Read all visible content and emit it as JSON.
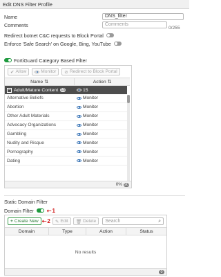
{
  "header": {
    "title": "Edit DNS Filter Profile"
  },
  "form": {
    "name_label": "Name",
    "name_value": "DNS_filter",
    "comments_label": "Comments",
    "comments_placeholder": "Comments",
    "comments_counter": "0/255",
    "redirect_label": "Redirect botnet C&C requests to Block Portal",
    "safe_search_label": "Enforce 'Safe Search' on Google, Bing, YouTube"
  },
  "category_filter": {
    "title": "FortiGuard Category Based Filter",
    "toolbar": {
      "allow": "Allow",
      "monitor": "Monitor",
      "redirect": "Redirect to Block Portal"
    },
    "columns": {
      "name": "Name",
      "action": "Action"
    },
    "group": {
      "label": "Adult/Mature Content",
      "count": "15",
      "action_count": "15"
    },
    "rows": [
      {
        "name": "Alternative Beliefs",
        "action": "Monitor"
      },
      {
        "name": "Abortion",
        "action": "Monitor"
      },
      {
        "name": "Other Adult Materials",
        "action": "Monitor"
      },
      {
        "name": "Advocacy Organizations",
        "action": "Monitor"
      },
      {
        "name": "Gambling",
        "action": "Monitor"
      },
      {
        "name": "Nudity and Risque",
        "action": "Monitor"
      },
      {
        "name": "Pornography",
        "action": "Monitor"
      },
      {
        "name": "Dating",
        "action": "Monitor"
      }
    ],
    "footer": {
      "percent": "0%",
      "count": "90"
    }
  },
  "static_filter": {
    "title": "Static Domain Filter",
    "domain_filter_label": "Domain Filter",
    "annotation_1": "1",
    "toolbar": {
      "create": "Create New",
      "edit": "Edit",
      "delete": "Delete",
      "search_placeholder": "Search"
    },
    "annotation_2": "2",
    "columns": {
      "domain": "Domain",
      "type": "Type",
      "action": "Action",
      "status": "Status"
    },
    "empty_text": "No results",
    "footer_count": "0"
  },
  "colors": {
    "accent_green": "#1e9a3e",
    "annotation_red": "#d11b1b",
    "group_row_bg": "#4d4d4d",
    "monitor_blue": "#2f6db3"
  }
}
